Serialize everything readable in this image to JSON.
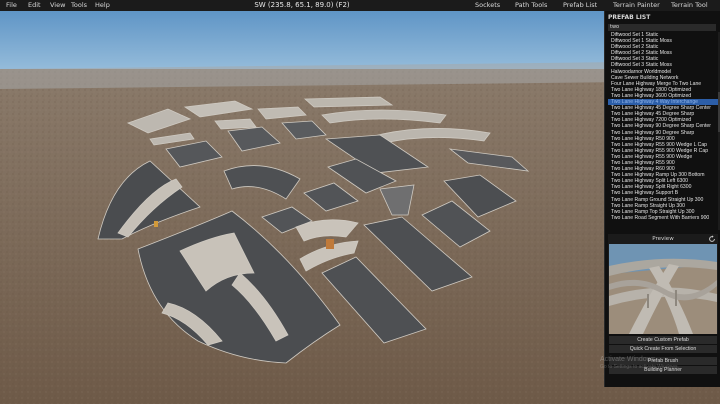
{
  "menu": {
    "file": "File",
    "edit": "Edit",
    "view": "View",
    "tools": "Tools",
    "help": "Help",
    "title": "SW (235.8, 65.1, 89.0) (F2)",
    "sockets": "Sockets",
    "path_tools": "Path Tools",
    "prefab_list": "Prefab List",
    "terrain_painter": "Terrain Painter",
    "terrain_tool": "Terrain Tool"
  },
  "panel": {
    "header": "PREFAB LIST",
    "search_value": "two",
    "preview_label": "Preview",
    "items": [
      "Diftwood Set 1 Static",
      "Diftwood Set 1 Static Moss",
      "Diftwood Set 2 Static",
      "Diftwood Set 2 Static Moss",
      "Diftwood Set 3 Static",
      "Diftwood Set 3 Static Moss",
      "Halwoodarnor Worldmodel",
      "Cave Sewer Building Network",
      "Four Lane Highway Merge To Two Lane",
      "Two Lane Highway 1800 Optimized",
      "Two Lane Highway 3600 Optimized",
      "Two Lane Highway 4 Way Interchange",
      "Two Lane Highway 45 Degree Sharp Center",
      "Two Lane Highway 45 Degree Sharp",
      "Two Lane Highway 7200 Optimized",
      "Two Lane Highway 90 Degree Sharp Center",
      "Two Lane Highway 90 Degree Sharp",
      "Two Lane Highway R50 900",
      "Two Lane Highway R55 900 Wedge L Cap",
      "Two Lane Highway R55 900 Wedge R Cap",
      "Two Lane Highway R55 900 Wedge",
      "Two Lane Highway R55 900",
      "Two Lane Highway R60 900",
      "Two Lane Highway Ramp Up 300 Bottom",
      "Two Lane Highway Split Left 6300",
      "Two Lane Highway Split Right 6300",
      "Two Lane Highway Support B",
      "Two Lane Ramp Ground Straight Up 300",
      "Two Lane Ramp Straight Up 300",
      "Two Lane Ramp Top Straight Up 300",
      "Two Lane Road Segment With Barriers 900"
    ],
    "selected_index": 11,
    "buttons": {
      "create_custom": "Create Custom Prefab",
      "quick_create": "Quick Create From Selection",
      "prefab_brush": "Prefab Brush",
      "building_planner": "Building Planner"
    },
    "watermark_line1": "Activate Windows",
    "watermark_line2": "Go to Settings to activate Windows."
  }
}
